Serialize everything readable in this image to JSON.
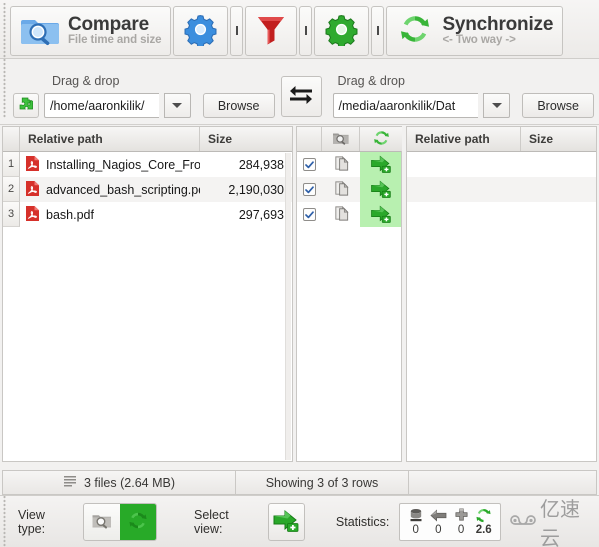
{
  "toolbar": {
    "compare": {
      "title": "Compare",
      "subtitle": "File time and size",
      "icon": "folder-search-icon"
    },
    "settings_blue": {
      "icon": "blue-gear-icon"
    },
    "sep1": {
      "glyph": "❘"
    },
    "filter": {
      "icon": "red-funnel-icon"
    },
    "sep2": {
      "glyph": "❘"
    },
    "settings_green": {
      "icon": "green-gear-icon"
    },
    "sep3": {
      "glyph": "❘"
    },
    "synchronize": {
      "title": "Synchronize",
      "subtitle": "<- Two way ->",
      "icon": "green-sync-icon"
    }
  },
  "paths": {
    "left": {
      "drag_drop_label": "Drag & drop",
      "value": "/home/aaronkilik/",
      "browse_label": "Browse",
      "puzzle_icon": "green-puzzle-icon",
      "dropdown_icon": "chevron-down-icon"
    },
    "swap": {
      "icon": "swap-arrows-icon"
    },
    "right": {
      "drag_drop_label": "Drag & drop",
      "value": "/media/aaronkilik/Dat",
      "browse_label": "Browse",
      "dropdown_icon": "chevron-down-icon"
    }
  },
  "grid": {
    "left_headers": {
      "name": "Relative path",
      "size": "Size"
    },
    "mid_headers": {
      "compare_icon": "gray-folder-search-icon",
      "sync_icon": "green-sync-icon"
    },
    "right_headers": {
      "name": "Relative path",
      "size": "Size"
    },
    "rows": [
      {
        "num": "1",
        "name": "Installing_Nagios_Core_Fro...",
        "size": "284,938",
        "icon": "pdf-file-icon",
        "checked": true,
        "action_left_icon": "copy-pages-icon",
        "action_right_icon": "green-arrow-plus-icon",
        "right_name": "",
        "right_size": ""
      },
      {
        "num": "2",
        "name": "advanced_bash_scripting.pdf",
        "size": "2,190,030",
        "icon": "pdf-file-icon",
        "checked": true,
        "action_left_icon": "copy-pages-icon",
        "action_right_icon": "green-arrow-plus-icon",
        "right_name": "",
        "right_size": ""
      },
      {
        "num": "3",
        "name": "bash.pdf",
        "size": "297,693",
        "icon": "pdf-file-icon",
        "checked": true,
        "action_left_icon": "copy-pages-icon",
        "action_right_icon": "green-arrow-plus-icon",
        "right_name": "",
        "right_size": ""
      }
    ]
  },
  "status": {
    "files_icon": "lines-icon",
    "files_text": "3 files  (2.64 MB)",
    "rows_text": "Showing 3 of 3 rows",
    "right_text": ""
  },
  "bottom": {
    "view_type_label": "View type:",
    "view_type_left_icon": "gray-folder-search-icon",
    "view_type_right_icon": "green-sync-icon",
    "select_view_label": "Select view:",
    "select_view_icon": "green-arrow-plus-icon",
    "statistics_label": "Statistics:",
    "stats": [
      {
        "icon": "delete-disk-icon",
        "value": "0"
      },
      {
        "icon": "left-arrow-icon",
        "value": "0"
      },
      {
        "icon": "plus-create-icon",
        "value": "0"
      },
      {
        "icon": "green-update-icon",
        "value": "2.6"
      }
    ],
    "watermark_text": "亿速云",
    "watermark_icon": "cloud-logo-icon"
  },
  "colors": {
    "green_accent": "#2faa2f",
    "row_highlight": "#b8f0b0",
    "pdf_red": "#d6302a",
    "blue_gear": "#3b8ede",
    "red_funnel": "#c21f1f"
  }
}
